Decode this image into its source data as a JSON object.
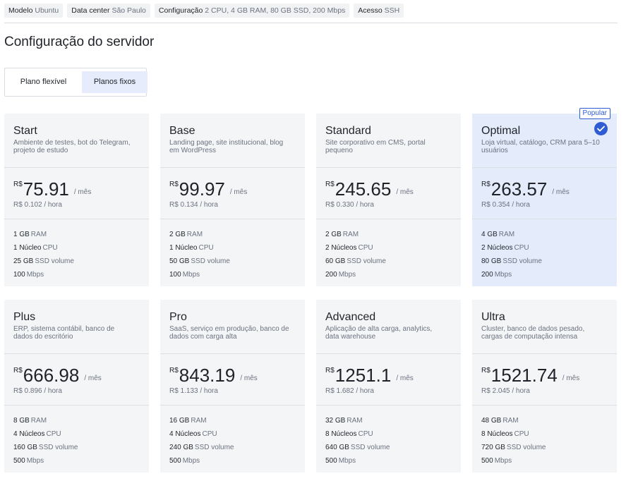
{
  "chips": [
    {
      "label": "Modelo",
      "value": "Ubuntu"
    },
    {
      "label": "Data center",
      "value": "São Paulo"
    },
    {
      "label": "Configuração",
      "value": "2 CPU, 4 GB RAM, 80 GB SSD, 200 Mbps"
    },
    {
      "label": "Acesso",
      "value": "SSH"
    }
  ],
  "page_title": "Configuração do servidor",
  "tabs": {
    "flexible": "Plano flexível",
    "fixed": "Planos fixos",
    "active": "fixed"
  },
  "currency": "R$",
  "per_month": "/ mês",
  "selected_badge": "Popular",
  "colors": {
    "accent": "#2f5bd3",
    "selected_card": "#e4ebfb",
    "card": "#f4f5f7"
  },
  "plans": [
    {
      "name": "Start",
      "desc": "Ambiente de testes, bot do Telegram, projeto de estudo",
      "price": "75.91",
      "hour": "R$ 0.102 / hora",
      "specs": [
        [
          "1 GB",
          "RAM"
        ],
        [
          "1 Núcleo",
          "CPU"
        ],
        [
          "25 GB",
          "SSD volume"
        ],
        [
          "100",
          "Mbps"
        ]
      ]
    },
    {
      "name": "Base",
      "desc": "Landing page, site institucional, blog em WordPress",
      "price": "99.97",
      "hour": "R$ 0.134 / hora",
      "specs": [
        [
          "2 GB",
          "RAM"
        ],
        [
          "1 Núcleo",
          "CPU"
        ],
        [
          "50 GB",
          "SSD volume"
        ],
        [
          "100",
          "Mbps"
        ]
      ]
    },
    {
      "name": "Standard",
      "desc": "Site corporativo em CMS, portal pequeno",
      "price": "245.65",
      "hour": "R$ 0.330 / hora",
      "specs": [
        [
          "2 GB",
          "RAM"
        ],
        [
          "2 Núcleos",
          "CPU"
        ],
        [
          "60 GB",
          "SSD volume"
        ],
        [
          "200",
          "Mbps"
        ]
      ]
    },
    {
      "name": "Optimal",
      "desc": "Loja virtual, catálogo, CRM para 5–10 usuários",
      "price": "263.57",
      "hour": "R$ 0.354 / hora",
      "specs": [
        [
          "4 GB",
          "RAM"
        ],
        [
          "2 Núcleos",
          "CPU"
        ],
        [
          "80 GB",
          "SSD volume"
        ],
        [
          "200",
          "Mbps"
        ]
      ],
      "selected": true
    },
    {
      "name": "Plus",
      "desc": "ERP, sistema contábil, banco de dados do escritório",
      "price": "666.98",
      "hour": "R$ 0.896 / hora",
      "specs": [
        [
          "8 GB",
          "RAM"
        ],
        [
          "4 Núcleos",
          "CPU"
        ],
        [
          "160 GB",
          "SSD volume"
        ],
        [
          "500",
          "Mbps"
        ]
      ]
    },
    {
      "name": "Pro",
      "desc": "SaaS, serviço em produção, banco de dados com carga alta",
      "price": "843.19",
      "hour": "R$ 1.133 / hora",
      "specs": [
        [
          "16 GB",
          "RAM"
        ],
        [
          "4 Núcleos",
          "CPU"
        ],
        [
          "240 GB",
          "SSD volume"
        ],
        [
          "500",
          "Mbps"
        ]
      ]
    },
    {
      "name": "Advanced",
      "desc": "Aplicação de alta carga, analytics, data warehouse",
      "price": "1251.1",
      "hour": "R$ 1.682 / hora",
      "specs": [
        [
          "32 GB",
          "RAM"
        ],
        [
          "8 Núcleos",
          "CPU"
        ],
        [
          "640 GB",
          "SSD volume"
        ],
        [
          "500",
          "Mbps"
        ]
      ]
    },
    {
      "name": "Ultra",
      "desc": "Cluster, banco de dados pesado, cargas de computação intensa",
      "price": "1521.74",
      "hour": "R$ 2.045 / hora",
      "specs": [
        [
          "48 GB",
          "RAM"
        ],
        [
          "8 Núcleos",
          "CPU"
        ],
        [
          "720 GB",
          "SSD volume"
        ],
        [
          "500",
          "Mbps"
        ]
      ]
    }
  ]
}
